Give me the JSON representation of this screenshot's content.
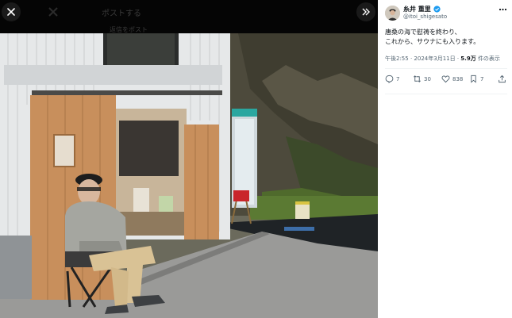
{
  "viewer": {
    "close_icon": "close-icon",
    "header_title": "ポストする",
    "ghost_label": "返信をポスト",
    "expand_icon": "chevrons-right-icon"
  },
  "tweet": {
    "author_name": "糸井 重里",
    "verified_color": "#1d9bf0",
    "handle": "@itoi_shigesato",
    "more_icon": "more-icon",
    "text_lines": [
      "唐桑の海で慰祷を終わり、",
      "これから、サウナにも入ります。"
    ],
    "time": "午後2:55",
    "date": "2024年3月11日",
    "views_count": "5.9万",
    "views_label": "件の表示",
    "actions": {
      "replies": "7",
      "reposts": "30",
      "likes": "838",
      "bookmarks": "7"
    }
  }
}
